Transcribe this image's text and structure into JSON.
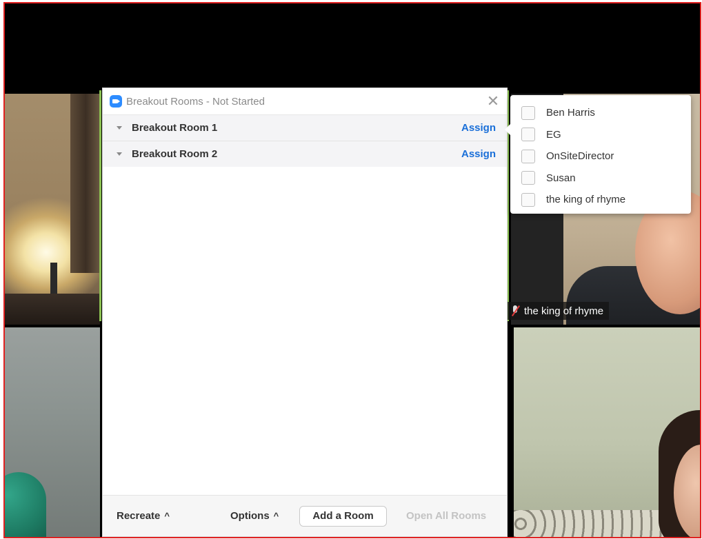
{
  "dialog": {
    "title": "Breakout Rooms - Not Started",
    "close_glyph": "✕",
    "rooms": [
      {
        "name": "Breakout Room 1",
        "action": "Assign"
      },
      {
        "name": "Breakout Room 2",
        "action": "Assign"
      }
    ],
    "footer": {
      "recreate": "Recreate",
      "options": "Options",
      "add_room": "Add a Room",
      "open_all": "Open All Rooms",
      "caret": "^"
    }
  },
  "assign_popup": {
    "participants": [
      "Ben Harris",
      "EG",
      "OnSiteDirector",
      "Susan",
      "the king of rhyme"
    ]
  },
  "video_tiles": {
    "top_right_name": "the king of rhyme"
  },
  "colors": {
    "accent_blue": "#1a6fd8",
    "zoom_blue": "#2d8cff",
    "frame_red": "#e02020",
    "active_speaker_green": "#8cc152"
  }
}
